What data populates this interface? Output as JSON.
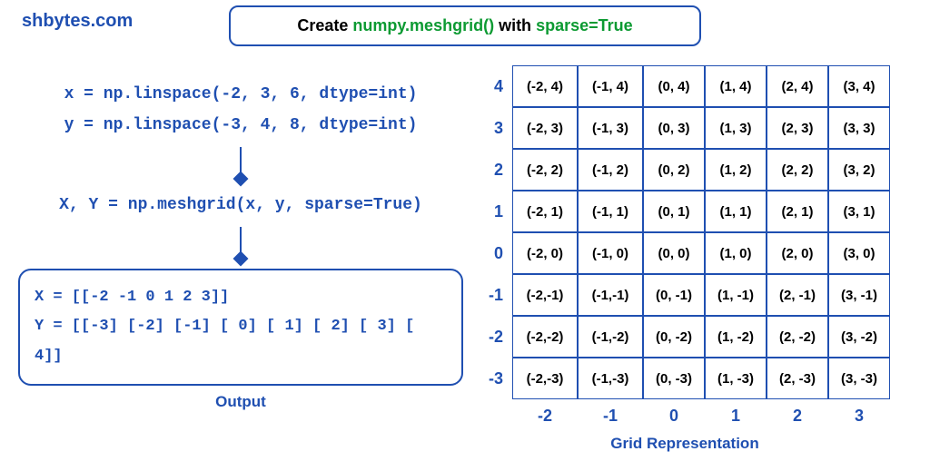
{
  "site_title": "shbytes.com",
  "header": {
    "prefix": "Create ",
    "func": "numpy.meshgrid()",
    "middle": " with ",
    "arg": "sparse=True"
  },
  "code": {
    "line1": "x = np.linspace(-2, 3, 6, dtype=int)",
    "line2": "y = np.linspace(-3, 4, 8, dtype=int)",
    "line3": "X, Y = np.meshgrid(x, y, sparse=True)"
  },
  "output": {
    "x_line": "X = [[-2 -1 0 1 2 3]]",
    "y_line": "Y = [[-3] [-2] [-1] [ 0] [ 1] [ 2] [ 3] [ 4]]",
    "label": "Output"
  },
  "grid": {
    "caption": "Grid Representation",
    "x_vals": [
      "-2",
      "-1",
      "0",
      "1",
      "2",
      "3"
    ],
    "y_vals": [
      "4",
      "3",
      "2",
      "1",
      "0",
      "-1",
      "-2",
      "-3"
    ],
    "cells": [
      [
        "(-2, 4)",
        "(-1, 4)",
        "(0, 4)",
        "(1, 4)",
        "(2, 4)",
        "(3, 4)"
      ],
      [
        "(-2, 3)",
        "(-1, 3)",
        "(0, 3)",
        "(1, 3)",
        "(2, 3)",
        "(3, 3)"
      ],
      [
        "(-2, 2)",
        "(-1, 2)",
        "(0, 2)",
        "(1, 2)",
        "(2, 2)",
        "(3, 2)"
      ],
      [
        "(-2, 1)",
        "(-1, 1)",
        "(0, 1)",
        "(1, 1)",
        "(2, 1)",
        "(3, 1)"
      ],
      [
        "(-2, 0)",
        "(-1, 0)",
        "(0, 0)",
        "(1, 0)",
        "(2, 0)",
        "(3, 0)"
      ],
      [
        "(-2,-1)",
        "(-1,-1)",
        "(0, -1)",
        "(1, -1)",
        "(2, -1)",
        "(3, -1)"
      ],
      [
        "(-2,-2)",
        "(-1,-2)",
        "(0, -2)",
        "(1, -2)",
        "(2, -2)",
        "(3, -2)"
      ],
      [
        "(-2,-3)",
        "(-1,-3)",
        "(0, -3)",
        "(1, -3)",
        "(2, -3)",
        "(3, -3)"
      ]
    ]
  }
}
